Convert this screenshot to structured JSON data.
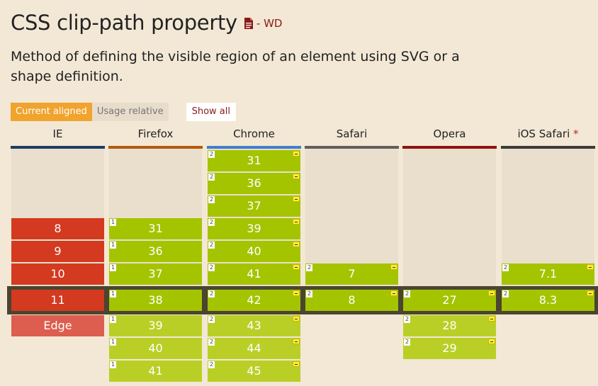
{
  "page": {
    "title": "CSS clip-path property",
    "spec_icon": "document-icon",
    "spec_status": "- WD",
    "description": "Method of defining the visible region of an element using SVG or a shape definition."
  },
  "toolbar": {
    "current_aligned": "Current aligned",
    "usage_relative": "Usage relative",
    "show_all": "Show all"
  },
  "colors": {
    "supported": "#a4c400",
    "supported_future": "#b9cf26",
    "unsupported": "#d33a1f",
    "unsupported_future": "#dd5d4f",
    "accent": "#f0a32d"
  },
  "browsers": [
    {
      "id": "ie",
      "name": "IE",
      "star": "",
      "color": "#1f3b66",
      "versions": [
        {
          "v": "8",
          "s": "r"
        },
        {
          "v": "9",
          "s": "r"
        },
        {
          "v": "10",
          "s": "r"
        },
        {
          "v": "11",
          "s": "r",
          "current": true
        },
        {
          "v": "Edge",
          "s": "rf"
        }
      ]
    },
    {
      "id": "firefox",
      "name": "Firefox",
      "star": "",
      "color": "#b35a0f",
      "versions": [
        {
          "v": "31",
          "s": "y",
          "note": "1"
        },
        {
          "v": "36",
          "s": "y",
          "note": "1"
        },
        {
          "v": "37",
          "s": "y",
          "note": "1"
        },
        {
          "v": "38",
          "s": "y",
          "note": "1",
          "current": true
        },
        {
          "v": "39",
          "s": "yf",
          "note": "1"
        },
        {
          "v": "40",
          "s": "yf",
          "note": "1"
        },
        {
          "v": "41",
          "s": "yf",
          "note": "1"
        }
      ]
    },
    {
      "id": "chrome",
      "name": "Chrome",
      "star": "",
      "color": "#3f7fcf",
      "versions": [
        {
          "v": "31",
          "s": "y",
          "note": "2",
          "prefix": true
        },
        {
          "v": "36",
          "s": "y",
          "note": "2",
          "prefix": true
        },
        {
          "v": "37",
          "s": "y",
          "note": "2",
          "prefix": true
        },
        {
          "v": "39",
          "s": "y",
          "note": "2",
          "prefix": true
        },
        {
          "v": "40",
          "s": "y",
          "note": "2",
          "prefix": true
        },
        {
          "v": "41",
          "s": "y",
          "note": "2",
          "prefix": true
        },
        {
          "v": "42",
          "s": "y",
          "note": "2",
          "prefix": true,
          "current": true
        },
        {
          "v": "43",
          "s": "yf",
          "note": "2",
          "prefix": true
        },
        {
          "v": "44",
          "s": "yf",
          "note": "2",
          "prefix": true
        },
        {
          "v": "45",
          "s": "yf",
          "note": "2",
          "prefix": true
        }
      ]
    },
    {
      "id": "safari",
      "name": "Safari",
      "star": "",
      "color": "#5f5f5f",
      "versions": [
        {
          "v": "7",
          "s": "y",
          "note": "2",
          "prefix": true
        },
        {
          "v": "8",
          "s": "y",
          "note": "2",
          "prefix": true,
          "current": true
        }
      ]
    },
    {
      "id": "opera",
      "name": "Opera",
      "star": "",
      "color": "#8e1212",
      "versions": [
        {
          "v": "27",
          "s": "y",
          "note": "2",
          "prefix": true,
          "current": true
        },
        {
          "v": "28",
          "s": "yf",
          "note": "2",
          "prefix": true
        },
        {
          "v": "29",
          "s": "yf",
          "note": "2",
          "prefix": true
        }
      ]
    },
    {
      "id": "ios-safari",
      "name": "iOS Safari",
      "star": "*",
      "color": "#3a3a3a",
      "versions": [
        {
          "v": "7.1",
          "s": "y",
          "note": "2",
          "prefix": true
        },
        {
          "v": "8.3",
          "s": "y",
          "note": "2",
          "prefix": true,
          "current": true
        }
      ]
    }
  ]
}
